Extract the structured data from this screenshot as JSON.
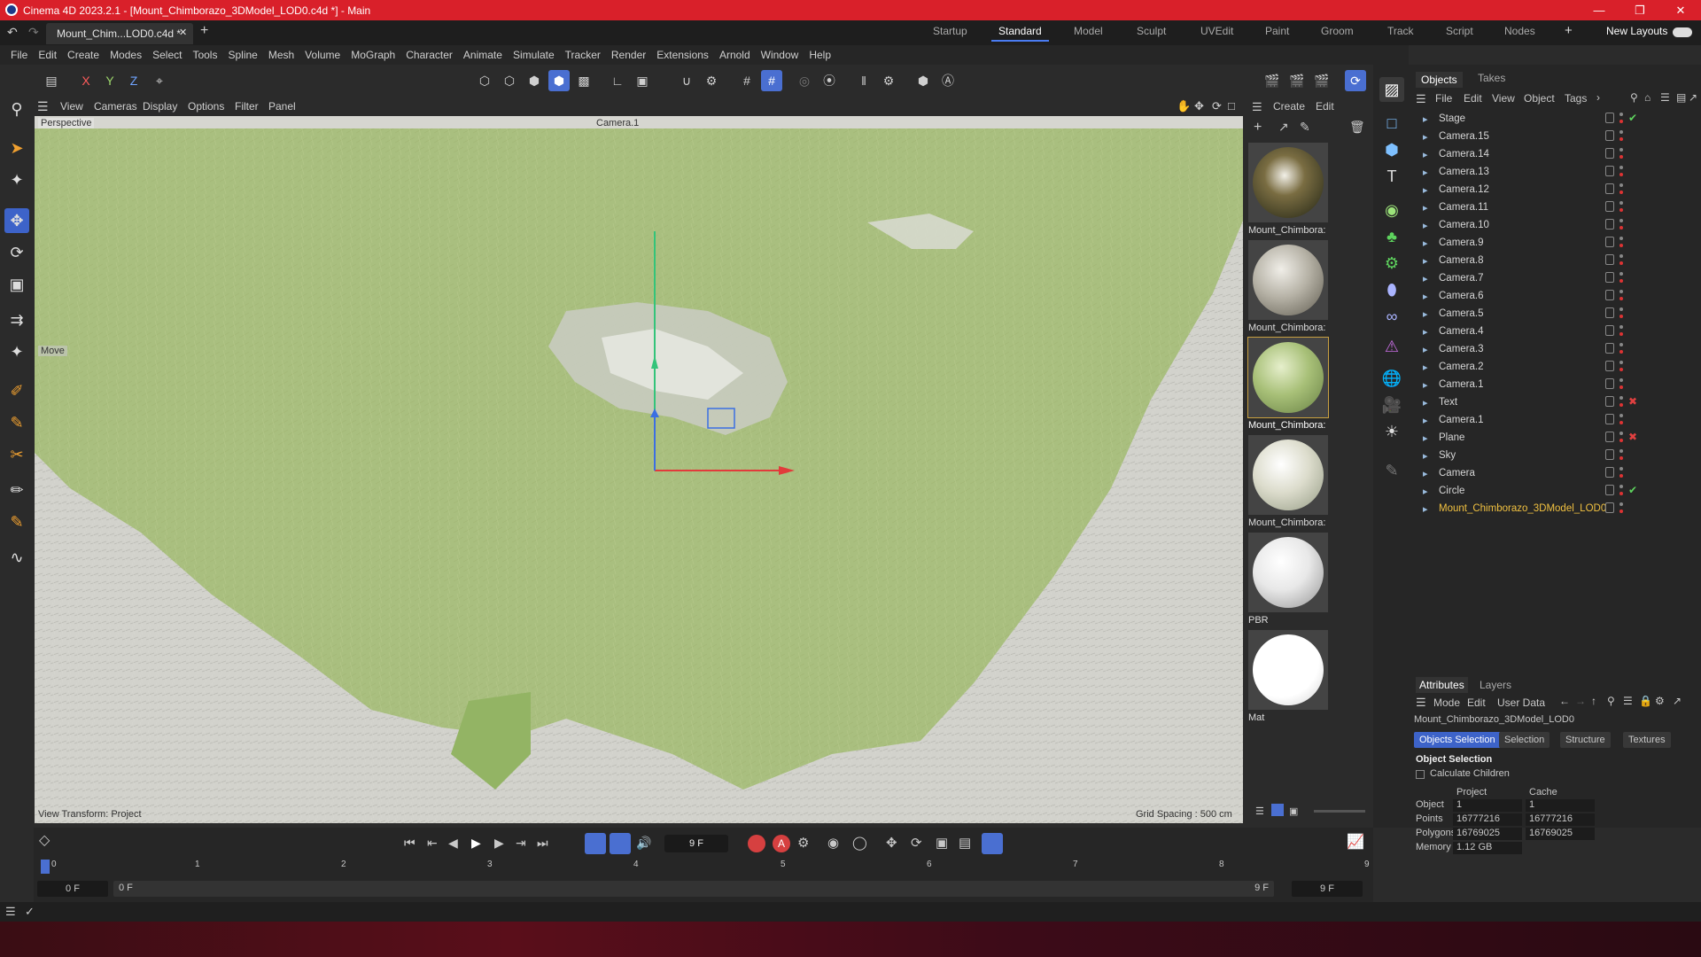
{
  "window": {
    "title": "Cinema 4D 2023.2.1 - [Mount_Chimborazo_3DModel_LOD0.c4d *] - Main",
    "minimize_icon": "minimize-icon",
    "maximize_icon": "restore-icon",
    "close_icon": "close-icon"
  },
  "tabs": {
    "doc_tab": "Mount_Chim...LOD0.c4d *",
    "layouts": [
      "Startup",
      "Standard",
      "Model",
      "Sculpt",
      "UVEdit",
      "Paint",
      "Groom",
      "Track",
      "Script",
      "Nodes"
    ],
    "active_layout": "Standard",
    "new_layouts": "New Layouts"
  },
  "menu": [
    "File",
    "Edit",
    "Create",
    "Modes",
    "Select",
    "Tools",
    "Spline",
    "Mesh",
    "Volume",
    "MoGraph",
    "Character",
    "Animate",
    "Simulate",
    "Tracker",
    "Render",
    "Extensions",
    "Arnold",
    "Window",
    "Help"
  ],
  "toolbar": {
    "x": "X",
    "y": "Y",
    "z": "Z"
  },
  "viewport": {
    "menu": [
      "View",
      "Cameras",
      "Display",
      "Options",
      "Filter",
      "Panel"
    ],
    "name": "Perspective",
    "camera": "Camera.1",
    "tool_label": "Move",
    "view_transform": "View Transform: Project",
    "grid_spacing": "Grid Spacing : 500 cm"
  },
  "materials": {
    "menu": [
      "Create",
      "Edit"
    ],
    "items": [
      {
        "label": "Mount_Chimbora:",
        "color": "#5a5030"
      },
      {
        "label": "Mount_Chimbora:",
        "color": "#b8b4a8"
      },
      {
        "label": "Mount_Chimbora:",
        "color": "#a8c078"
      },
      {
        "label": "Mount_Chimbora:",
        "color": "#dcdccc"
      },
      {
        "label": "PBR",
        "color": "#e8e8e8"
      },
      {
        "label": "Mat",
        "color": "#ffffff"
      }
    ]
  },
  "objects_panel": {
    "tabs": [
      "Objects",
      "Takes"
    ],
    "menu": [
      "File",
      "Edit",
      "View",
      "Object",
      "Tags"
    ],
    "items": [
      {
        "name": "Stage",
        "tag": "check"
      },
      {
        "name": "Camera.15"
      },
      {
        "name": "Camera.14"
      },
      {
        "name": "Camera.13"
      },
      {
        "name": "Camera.12"
      },
      {
        "name": "Camera.11"
      },
      {
        "name": "Camera.10"
      },
      {
        "name": "Camera.9"
      },
      {
        "name": "Camera.8"
      },
      {
        "name": "Camera.7"
      },
      {
        "name": "Camera.6"
      },
      {
        "name": "Camera.5"
      },
      {
        "name": "Camera.4"
      },
      {
        "name": "Camera.3"
      },
      {
        "name": "Camera.2"
      },
      {
        "name": "Camera.1"
      },
      {
        "name": "Text",
        "tag": "x"
      },
      {
        "name": "Camera.1"
      },
      {
        "name": "Plane",
        "tag": "x"
      },
      {
        "name": "Sky"
      },
      {
        "name": "Camera"
      },
      {
        "name": "Circle",
        "tag": "check"
      },
      {
        "name": "Mount_Chimborazo_3DModel_LOD0",
        "highlight": true
      }
    ]
  },
  "attributes": {
    "tabs": [
      "Attributes",
      "Layers"
    ],
    "menu": [
      "Mode",
      "Edit",
      "User Data"
    ],
    "object_name": "Mount_Chimborazo_3DModel_LOD0",
    "subtabs": [
      "Objects Selection",
      "Selection",
      "Structure",
      "Textures"
    ],
    "section": "Object Selection",
    "calc_children": "Calculate Children",
    "col_project": "Project",
    "col_cache": "Cache",
    "rows": [
      {
        "label": "Object",
        "project": "1",
        "cache": "1"
      },
      {
        "label": "Points",
        "project": "16777216",
        "cache": "16777216"
      },
      {
        "label": "Polygons",
        "project": "16769025",
        "cache": "16769025"
      },
      {
        "label": "Memory",
        "project": "1.12 GB",
        "cache": ""
      }
    ]
  },
  "timeline": {
    "current_frame": "9 F",
    "ticks": [
      "0",
      "1",
      "2",
      "3",
      "4",
      "5",
      "6",
      "7",
      "8",
      "9"
    ],
    "start": "0 F",
    "range_start": "0 F",
    "range_end": "9 F",
    "end": "9 F"
  }
}
